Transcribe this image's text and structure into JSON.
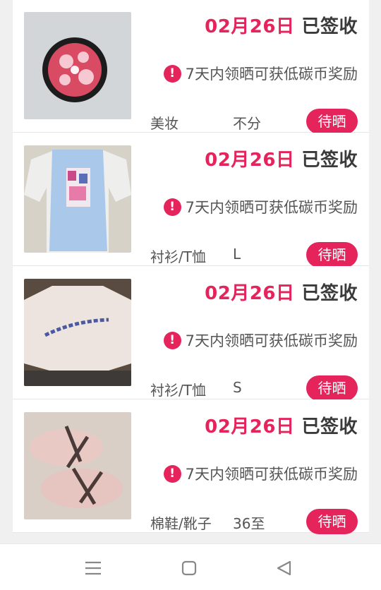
{
  "orders": [
    {
      "date": "02月26日",
      "status": "已签收",
      "promo": "7天内领晒可获低碳币奖励",
      "category": "美妆",
      "size": "不分",
      "badge": "待晒",
      "image": "compact-makeup-photo"
    },
    {
      "date": "02月26日",
      "status": "已签收",
      "promo": "7天内领晒可获低碳币奖励",
      "category": "衬衫/T恤",
      "size": "L",
      "badge": "待晒",
      "image": "blue-vest-tshirt-photo"
    },
    {
      "date": "02月26日",
      "status": "已签收",
      "promo": "7天内领晒可获低碳币奖励",
      "category": "衬衫/T恤",
      "size": "S",
      "badge": "待晒",
      "image": "white-tshirt-photo"
    },
    {
      "date": "02月26日",
      "status": "已签收",
      "promo": "7天内领晒可获低碳币奖励",
      "category": "棉鞋/靴子",
      "size": "36至",
      "badge": "待晒",
      "image": "pink-fluffy-shoes-photo"
    }
  ],
  "icons": {
    "warn": "!",
    "nav_menu": "menu-icon",
    "nav_home": "home-square-icon",
    "nav_back": "back-triangle-icon"
  },
  "colors": {
    "accent": "#e5245c",
    "card_bg": "#ffffff",
    "page_bg": "#f0f0f0"
  }
}
